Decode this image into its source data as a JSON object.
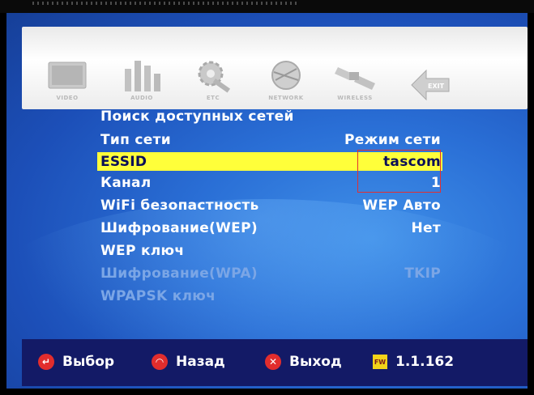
{
  "menubar": {
    "tabs": [
      {
        "label": "VIDEO",
        "icon": "tv-icon"
      },
      {
        "label": "AUDIO",
        "icon": "speaker-icon"
      },
      {
        "label": "ETC",
        "icon": "gear-wrench-icon"
      },
      {
        "label": "NETWORK",
        "icon": "globe-icon"
      },
      {
        "label": "WIRELESS",
        "icon": "satellite-icon"
      },
      {
        "label": "EXIT",
        "icon": "exit-arrow-icon"
      }
    ]
  },
  "settings": {
    "search_networks": "Поиск доступных сетей",
    "network_type": {
      "label": "Тип сети",
      "value": "Режим сети"
    },
    "essid": {
      "label": "ESSID",
      "value": "tascom"
    },
    "channel": {
      "label": "Канал",
      "value": "1"
    },
    "wifi_security": {
      "label": "WiFi безопастность",
      "value": "WEP Авто"
    },
    "encryption_wep": {
      "label": "Шифрование(WEP)",
      "value": "Нет"
    },
    "wep_key": {
      "label": "WEP ключ"
    },
    "encryption_wpa": {
      "label": "Шифрование(WPA)",
      "value": "TKIP"
    },
    "wpapsk_key": {
      "label": "WPAPSK ключ"
    }
  },
  "footer": {
    "select": "Выбор",
    "back": "Назад",
    "exit": "Выход",
    "fw_badge": "FW",
    "version": "1.1.162"
  },
  "colors": {
    "selection": "#ffff3a",
    "footer_bg": "#131a66",
    "panel_blue": "#2a6fd6",
    "highlight_box": "#e23030"
  }
}
